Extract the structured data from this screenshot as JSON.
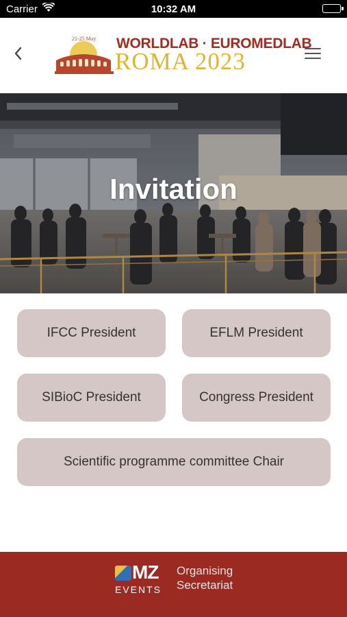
{
  "status_bar": {
    "carrier": "Carrier",
    "time": "10:32 AM"
  },
  "header": {
    "logo": {
      "line1": "WORLDLAB · EUROMEDLAB",
      "line2": "ROMA 2023",
      "dates": "21-25 May"
    }
  },
  "hero": {
    "title": "Invitation"
  },
  "buttons": [
    {
      "label": "IFCC President"
    },
    {
      "label": "EFLM President"
    },
    {
      "label": "SIBioC President"
    },
    {
      "label": "Congress President"
    },
    {
      "label": "Scientific programme committee Chair"
    }
  ],
  "footer": {
    "brand": "MZ",
    "brand_sub": "EVENTS",
    "org_line1": "Organising",
    "org_line2": "Secretariat"
  },
  "colors": {
    "button_bg": "#d5c7c5",
    "footer_bg": "#9b2a23",
    "logo_red": "#a52a1f",
    "logo_gold": "#e0b433"
  }
}
